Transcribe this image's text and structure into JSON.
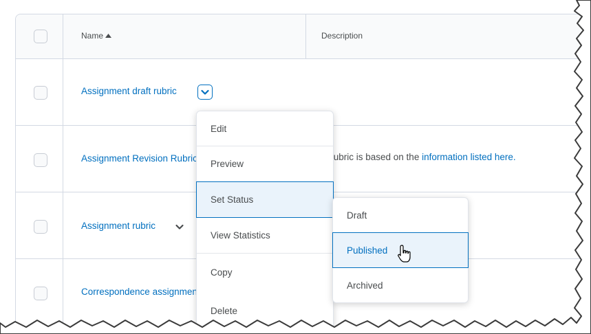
{
  "table": {
    "headers": {
      "name": "Name",
      "description": "Description"
    },
    "rows": [
      {
        "name": "Assignment draft rubric",
        "description": "",
        "description_link": ""
      },
      {
        "name": "Assignment Revision Rubric",
        "description": "This rubric is based on the ",
        "description_link": "information listed here."
      },
      {
        "name": "Assignment rubric",
        "description": "",
        "description_link": ""
      },
      {
        "name": "Correspondence assignment rubric",
        "description": "",
        "description_link": ""
      }
    ]
  },
  "context_menu": {
    "items": [
      "Edit",
      "Preview",
      "Set Status",
      "View Statistics",
      "Copy",
      "Delete"
    ],
    "active": "Set Status"
  },
  "status_submenu": {
    "items": [
      "Draft",
      "Published",
      "Archived"
    ],
    "hovered": "Published"
  },
  "colors": {
    "link": "#006fbf",
    "border": "#d3d9e3",
    "active_bg": "#eaf3fb"
  },
  "icons": [
    "sort-up-icon",
    "chevron-down-icon",
    "hand-cursor-icon"
  ]
}
